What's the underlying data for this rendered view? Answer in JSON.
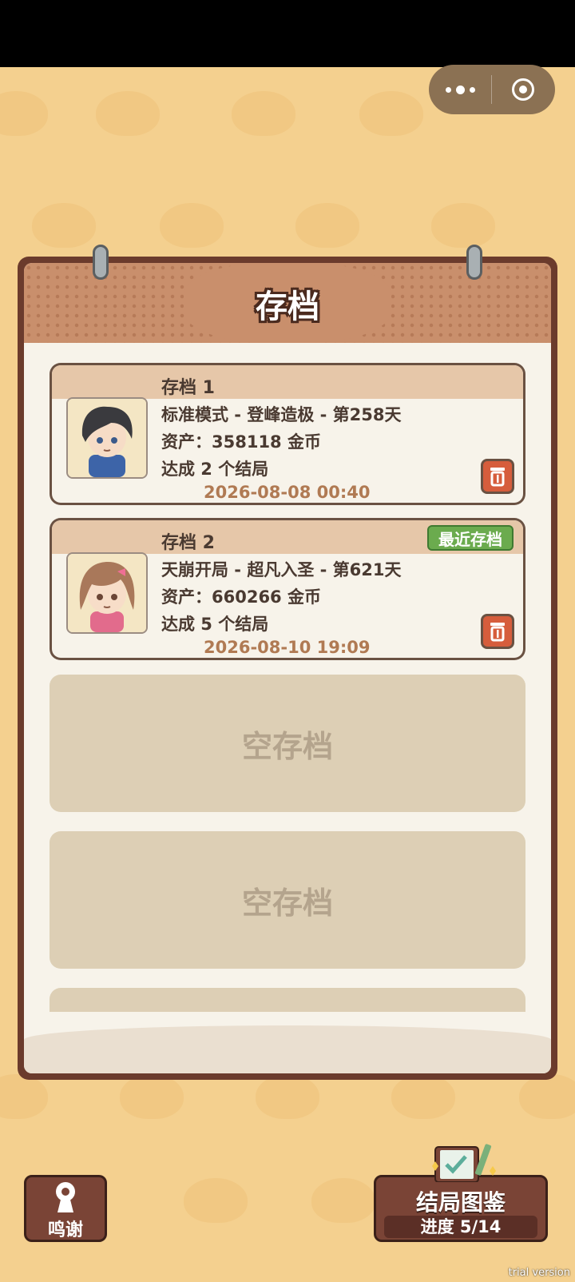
{
  "header": {
    "title": "存档"
  },
  "capsule": {
    "menu_icon": "more-dots-icon",
    "close_icon": "target-close-icon"
  },
  "saves": [
    {
      "name": "存档 1",
      "mode_line": "标准模式 - 登峰造极 - 第258天",
      "assets_line": "资产：358118 金币",
      "endings_line": "达成 2 个结局",
      "date": "2026-08-08 00:40",
      "badge": ""
    },
    {
      "name": "存档 2",
      "mode_line": "天崩开局 - 超凡入圣 - 第621天",
      "assets_line": "资产：660266 金币",
      "endings_line": "达成 5 个结局",
      "date": "2026-08-10 19:09",
      "badge": "最近存档"
    }
  ],
  "empty_slots": [
    "空存档",
    "空存档",
    ""
  ],
  "buttons": {
    "thanks_label": "鸣谢",
    "gallery_title": "结局图鉴",
    "gallery_progress": "进度  5/14"
  },
  "watermark": "trial version",
  "colors": {
    "accent_red": "#d65d3c",
    "badge_green": "#6bab4e",
    "frame_brown": "#6b3b2c"
  }
}
